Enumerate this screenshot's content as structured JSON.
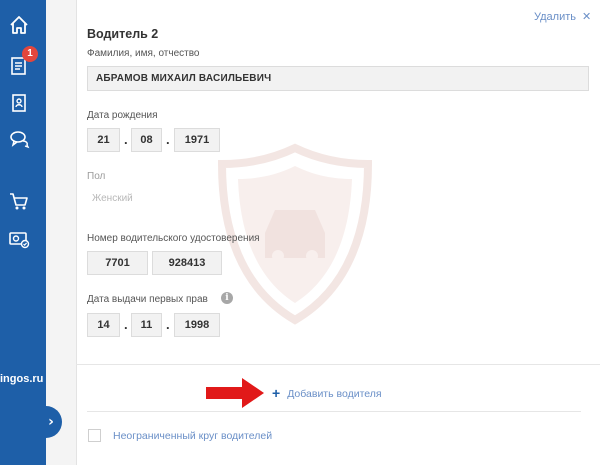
{
  "sidebar": {
    "notification_count": "1",
    "brand": "ingos.ru",
    "toggle": "›",
    "icons": [
      "home-icon",
      "documents-icon",
      "policy-icon",
      "chat-icon",
      "cart-icon",
      "payment-card-icon"
    ]
  },
  "driver": {
    "title": "Водитель 2",
    "delete_label": "Удалить",
    "delete_icon": "✕",
    "name_label": "Фамилия, имя, отчество",
    "name_value": "АБРАМОВ МИХАИЛ ВАСИЛЬЕВИЧ",
    "birth_label": "Дата рождения",
    "birth_day": "21",
    "birth_month": "08",
    "birth_year": "1971",
    "gender_label": "Пол",
    "gender_value": "Женский",
    "license_label": "Номер водительского удостоверения",
    "license_series": "7701",
    "license_number": "928413",
    "first_license_label": "Дата выдачи первых прав",
    "info_icon": "i",
    "first_license_day": "14",
    "first_license_month": "11",
    "first_license_year": "1998",
    "date_separator": "."
  },
  "actions": {
    "add_icon": "+",
    "add_driver": "Добавить водителя",
    "unlimited_drivers": "Неограниченный круг водителей"
  },
  "colors": {
    "sidebar": "#1e5fa8",
    "link": "#6a8fc7",
    "badge": "#e2463d",
    "arrow": "#e11919"
  }
}
